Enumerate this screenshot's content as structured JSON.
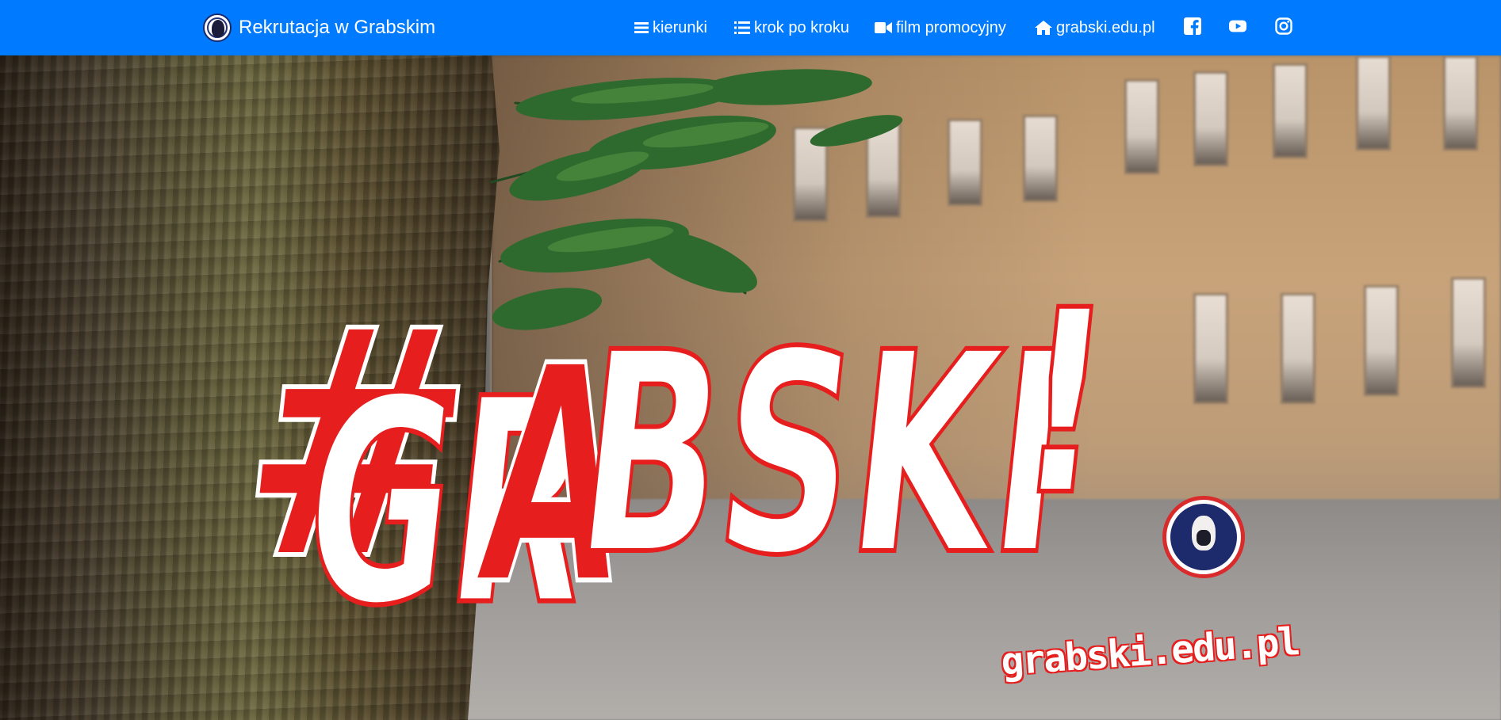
{
  "brand": {
    "title": "Rekrutacja w Grabskim"
  },
  "nav": {
    "items": [
      {
        "icon": "bars-icon",
        "label": "kierunki"
      },
      {
        "icon": "list-icon",
        "label": "krok po kroku"
      },
      {
        "icon": "video-icon",
        "label": "film promocyjny"
      },
      {
        "icon": "home-icon",
        "label": "grabski.edu.pl"
      }
    ],
    "social": [
      {
        "icon": "facebook-icon"
      },
      {
        "icon": "youtube-icon"
      },
      {
        "icon": "instagram-icon"
      }
    ]
  },
  "hero": {
    "hashtag": "#",
    "word_part1": "GR",
    "word_part2": "A",
    "word_part3": "BSKI",
    "exclaim": "!",
    "url": "grabski.edu.pl"
  },
  "colors": {
    "navbar": "#007bff",
    "accent_red": "#e61e1e",
    "white": "#ffffff"
  }
}
